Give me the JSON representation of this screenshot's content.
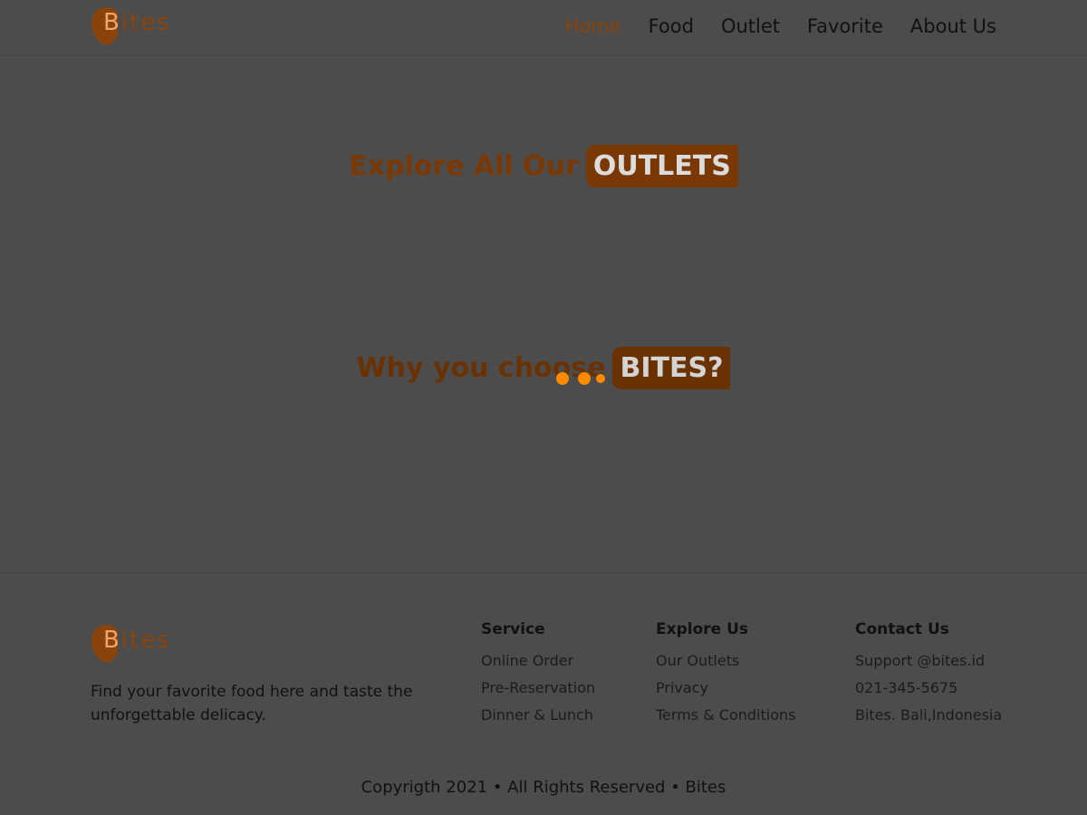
{
  "brand": {
    "logo_letter": "B",
    "logo_rest": "ites"
  },
  "nav": {
    "items": [
      {
        "label": "Home",
        "active": true
      },
      {
        "label": "Food"
      },
      {
        "label": "Outlet"
      },
      {
        "label": "Favorite"
      },
      {
        "label": "About Us"
      }
    ]
  },
  "sections": {
    "outlets": {
      "text": "Explore All Our",
      "highlight": "OUTLETS"
    },
    "why": {
      "text": "Why you choose",
      "highlight": "BITES?"
    }
  },
  "footer": {
    "tagline": "Find your favorite food here and taste the unforgettable delicacy.",
    "columns": [
      {
        "title": "Service",
        "links": [
          "Online Order",
          "Pre-Reservation",
          "Dinner & Lunch"
        ]
      },
      {
        "title": "Explore Us",
        "links": [
          "Our Outlets",
          "Privacy",
          "Terms & Conditions"
        ]
      },
      {
        "title": "Contact Us",
        "links": [
          "Support @bites.id",
          "021-345-5675",
          "Bites. Bali,Indonesia"
        ]
      }
    ],
    "copyright": "Copyrigth 2021 • All Rights Reserved • Bites"
  },
  "colors": {
    "accent": "#8a440b",
    "loader": "#ff8a00",
    "overlay_bg": "#4c4c4c"
  }
}
